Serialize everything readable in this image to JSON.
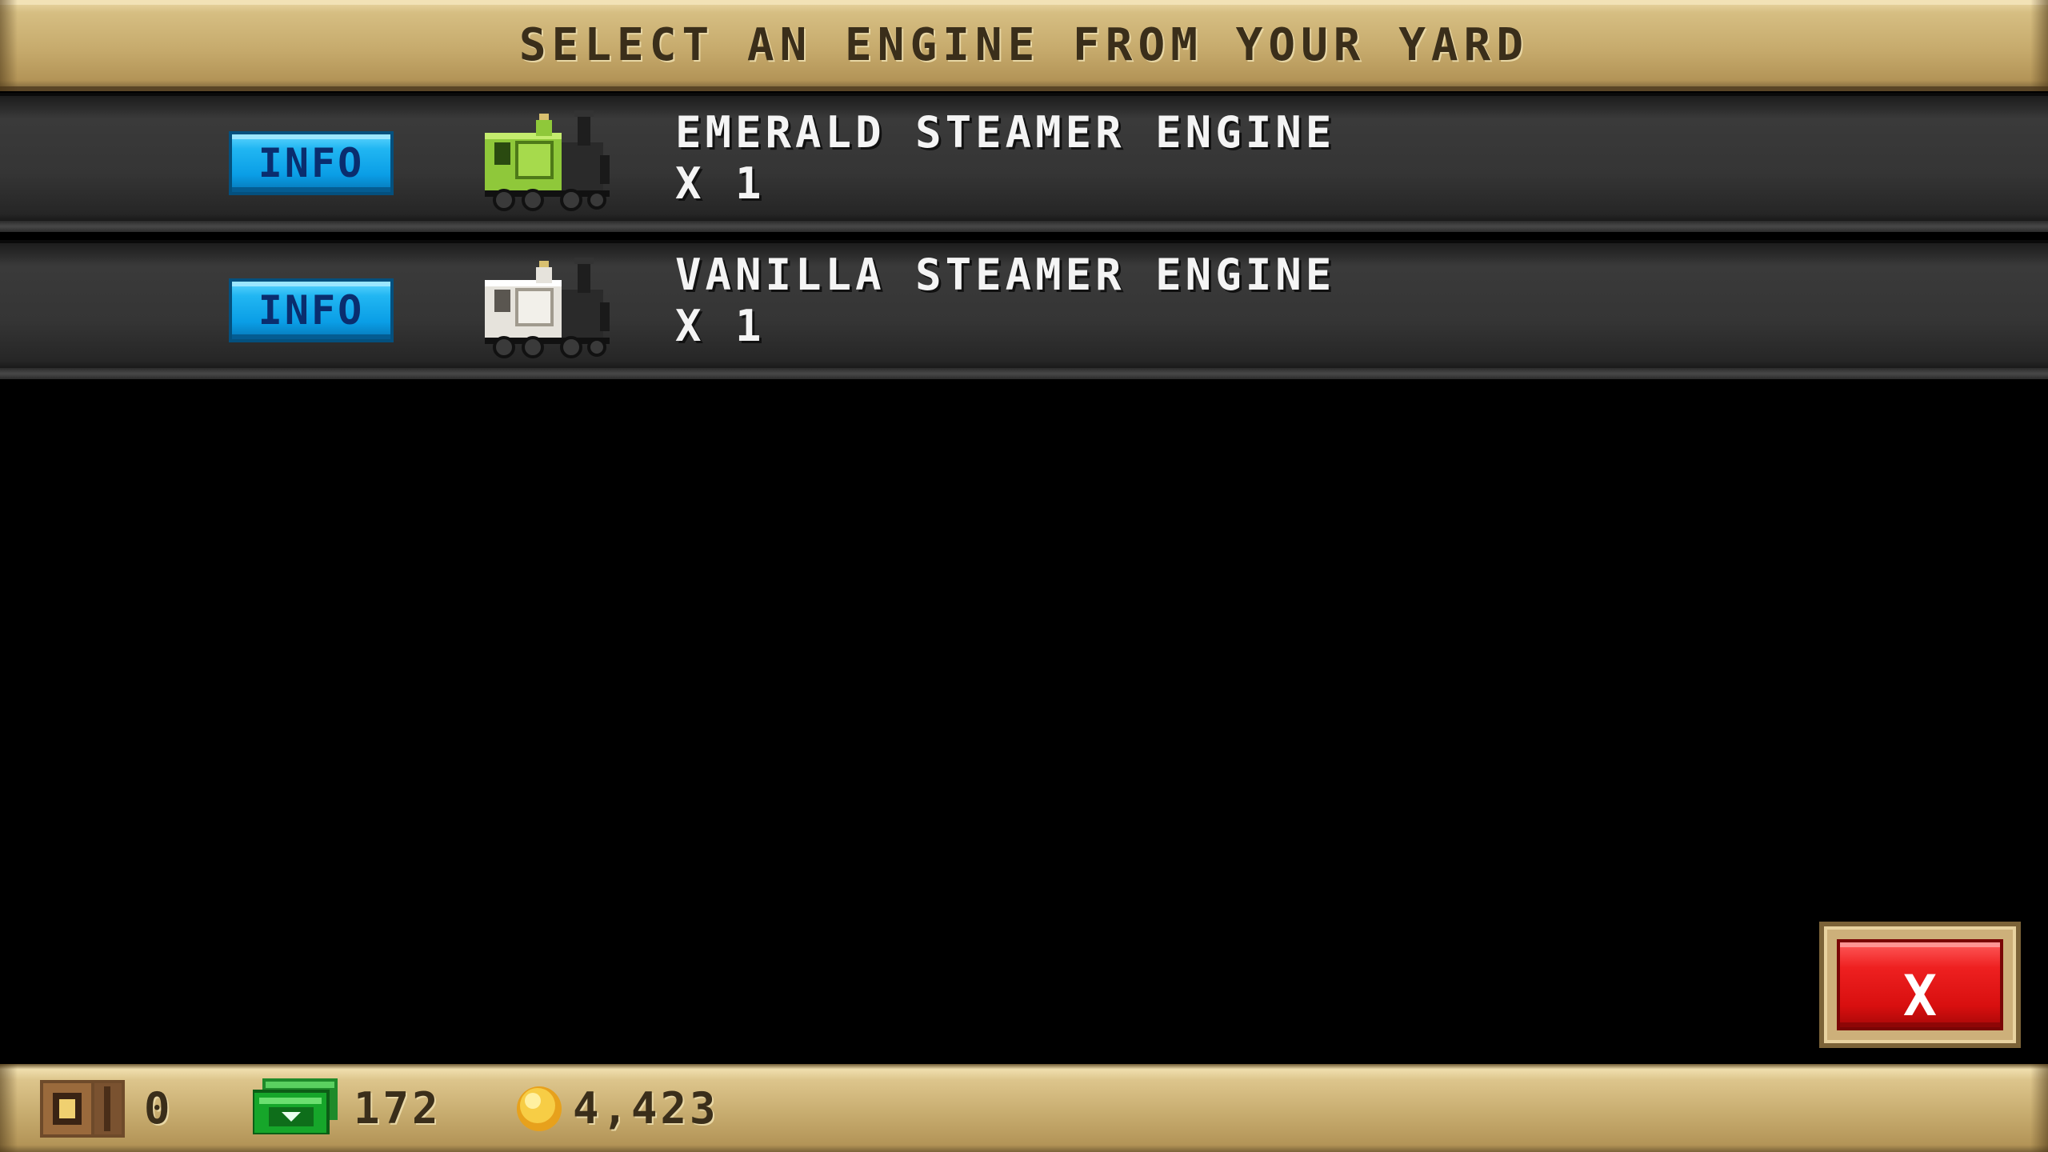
{
  "header": {
    "title": "SELECT AN ENGINE FROM YOUR YARD"
  },
  "engines": [
    {
      "name": "EMERALD STEAMER ENGINE",
      "count": "X 1",
      "info_label": "INFO",
      "icon": "green-steam-locomotive-icon",
      "color": "#8fc83a"
    },
    {
      "name": "VANILLA STEAMER ENGINE",
      "count": "X 1",
      "info_label": "INFO",
      "icon": "white-steam-locomotive-icon",
      "color": "#e6e3dc"
    }
  ],
  "close_button": {
    "label": "X",
    "color": "#e81c1c"
  },
  "status_bar": {
    "crates": {
      "value": "0",
      "icon": "crate-icon"
    },
    "cash": {
      "value": "172",
      "icon": "cash-icon"
    },
    "coins": {
      "value": "4,423",
      "icon": "coin-icon"
    }
  }
}
